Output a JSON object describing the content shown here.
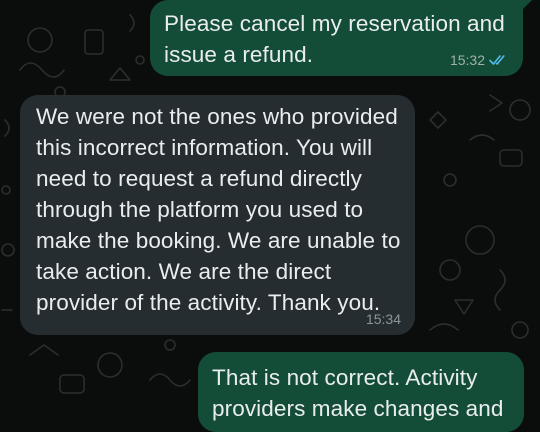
{
  "conversation": {
    "messages": [
      {
        "direction": "outgoing",
        "text": "Please cancel my reservation and\nissue a refund.",
        "time": "15:32",
        "status_icon": "double-check-read-icon"
      },
      {
        "direction": "incoming",
        "text": "We were not the ones who provided\nthis incorrect information. You will\nneed to request a refund directly\nthrough the platform you used to\nmake the booking. We are unable to\ntake action. We are the direct\nprovider of the activity. Thank you.",
        "time": "15:34"
      },
      {
        "direction": "outgoing",
        "text": "That is not correct. Activity\nproviders make changes and"
      }
    ]
  },
  "colors": {
    "background": "#0b0d0c",
    "outgoing_bubble": "#144d37",
    "incoming_bubble": "#262d31",
    "message_text": "#e9edef",
    "read_ticks": "#53bdeb"
  }
}
